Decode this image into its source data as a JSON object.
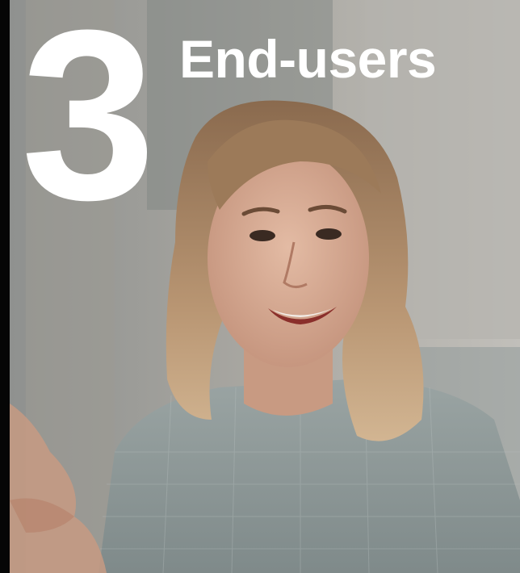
{
  "overlay": {
    "number": "3",
    "title": "End-users"
  },
  "photo": {
    "subject": "smiling-woman-portrait"
  },
  "colors": {
    "text": "#ffffff",
    "border": "#060606"
  }
}
